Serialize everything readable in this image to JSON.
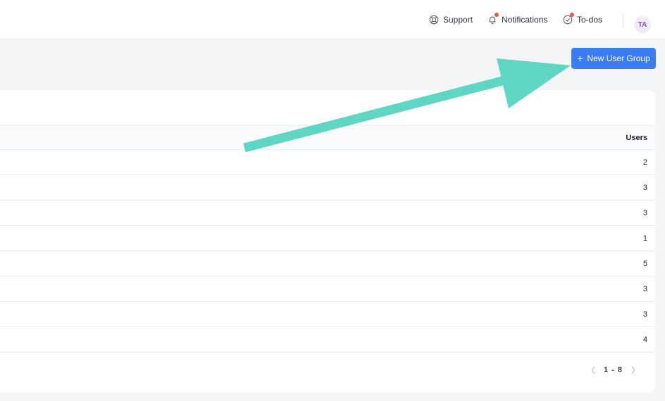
{
  "header": {
    "support_label": "Support",
    "notifications_label": "Notifications",
    "todos_label": "To-dos",
    "avatar_initials": "TA",
    "notification_dot_color": "#f0524f"
  },
  "toolbar": {
    "new_group_label": "New User Group",
    "button_color": "#3b7cf4"
  },
  "table": {
    "columns": {
      "users": "Users"
    },
    "rows": [
      {
        "users": "2"
      },
      {
        "users": "3"
      },
      {
        "users": "3"
      },
      {
        "users": "1"
      },
      {
        "users": "5"
      },
      {
        "users": "3"
      },
      {
        "users": "3"
      },
      {
        "users": "4"
      }
    ]
  },
  "pagination": {
    "range": "1 - 8",
    "prev_icon": "chevron-left-icon",
    "next_icon": "chevron-right-icon"
  },
  "annotation": {
    "arrow_color": "#5fd6c4"
  },
  "avatar": {
    "bg": "#f1eaf8",
    "text_color": "#7b58b4"
  }
}
